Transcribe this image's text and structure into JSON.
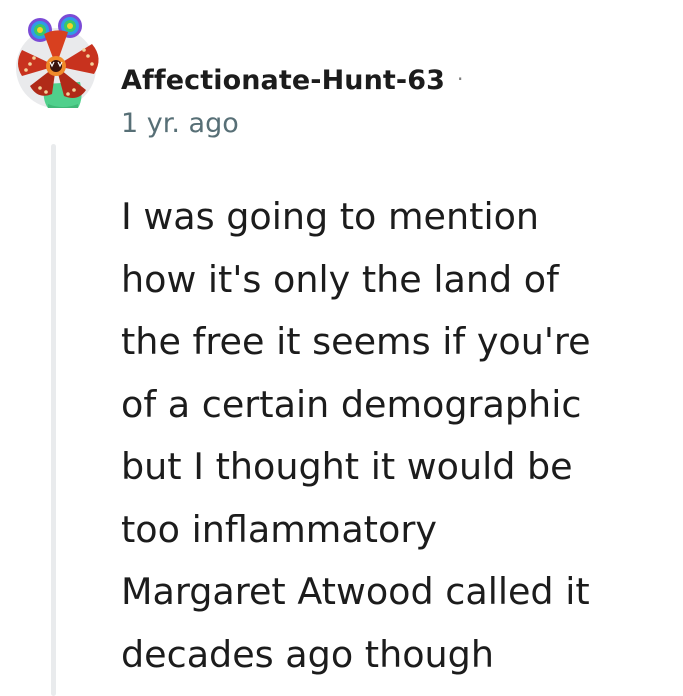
{
  "comment": {
    "author": "Affectionate-Hunt-63",
    "separator": "·",
    "timestamp": "1 yr. ago",
    "body_lines": [
      "I was going to mention",
      "how it's only the land of",
      "the free it seems if you're",
      "of a certain demographic",
      "but I thought it would be",
      "too inflammatory",
      "Margaret Atwood called it",
      "decades ago though"
    ],
    "avatar_icon": "demogorgon-snoo-avatar-icon"
  },
  "colors": {
    "text_primary": "#1c1c1c",
    "text_meta": "#576f76",
    "thread_line": "#e9ebed",
    "avatar_green": "#55d08a",
    "avatar_red": "#c8321e",
    "avatar_orange": "#f0821e"
  }
}
